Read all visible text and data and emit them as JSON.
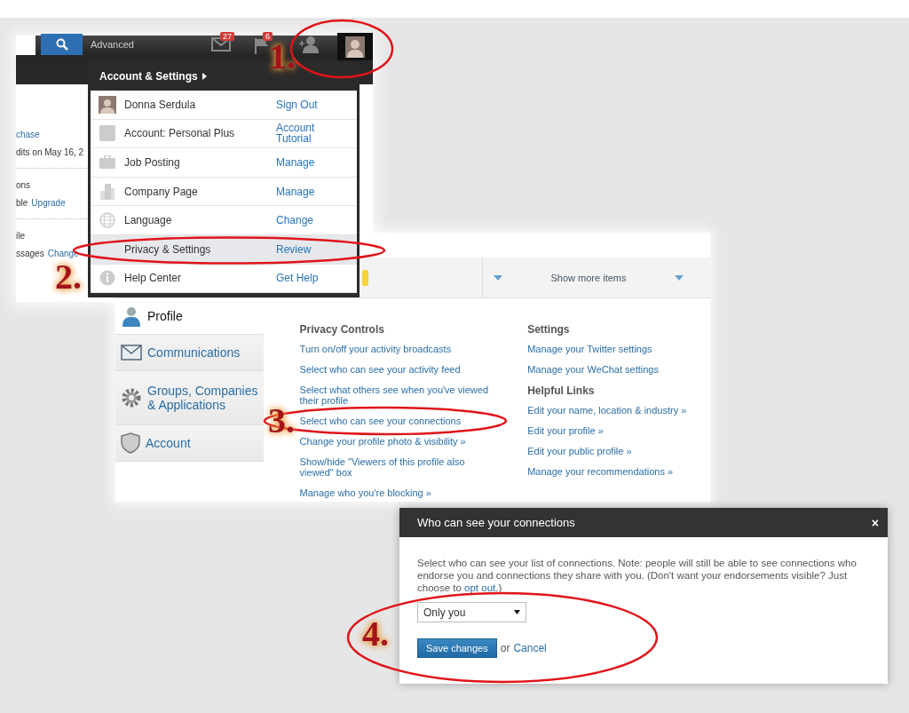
{
  "navbar": {
    "advanced": "Advanced",
    "notifications": [
      {
        "kind": "mail",
        "count": "27"
      },
      {
        "kind": "flag",
        "count": "6"
      }
    ]
  },
  "background_page": {
    "lines": [
      {
        "parts": [
          {
            "text": "chase",
            "kind": "link"
          }
        ]
      },
      {
        "parts": [
          {
            "text": "dits on May 16, 2",
            "kind": "text"
          }
        ]
      },
      {
        "parts": [
          {
            "text": "ons",
            "kind": "text"
          }
        ]
      },
      {
        "parts": [
          {
            "text": "ble",
            "kind": "text"
          },
          {
            "text": "Upgrade",
            "kind": "link"
          }
        ]
      },
      {
        "parts": [
          {
            "text": "ile",
            "kind": "text"
          }
        ]
      },
      {
        "parts": [
          {
            "text": "ssages",
            "kind": "text"
          },
          {
            "text": "Change",
            "kind": "link"
          }
        ]
      }
    ]
  },
  "menu": {
    "title": "Account & Settings",
    "rows": [
      {
        "kind": "avatar",
        "label": "Donna Serdula",
        "action": "Sign Out",
        "selected": false
      },
      {
        "kind": "logo",
        "label": "Account: Personal Plus",
        "action": "Account Tutorial",
        "selected": false
      },
      {
        "kind": "briefcase",
        "label": "Job Posting",
        "action": "Manage",
        "selected": false
      },
      {
        "kind": "building",
        "label": "Company Page",
        "action": "Manage",
        "selected": false
      },
      {
        "kind": "globe",
        "label": "Language",
        "action": "Change",
        "selected": false
      },
      {
        "kind": "plain",
        "label": "Privacy & Settings",
        "action": "Review",
        "selected": true
      },
      {
        "kind": "info",
        "label": "Help Center",
        "action": "Get Help",
        "selected": false
      }
    ]
  },
  "settings": {
    "show_more": "Show more items",
    "nav": [
      {
        "kind": "person",
        "label": "Profile",
        "selected": true
      },
      {
        "kind": "envelope",
        "label": "Communications",
        "selected": false
      },
      {
        "kind": "gear",
        "label": "Groups, Companies & Applications",
        "selected": false
      },
      {
        "kind": "shield",
        "label": "Account",
        "selected": false
      }
    ],
    "privacy_controls": {
      "heading": "Privacy Controls",
      "links": [
        "Turn on/off your activity broadcasts",
        "Select who can see your activity feed",
        "Select what others see when you've viewed their profile",
        "Select who can see your connections",
        "Change your profile photo & visibility »",
        "Show/hide \"Viewers of this profile also viewed\" box",
        "Manage who you're blocking »"
      ]
    },
    "settings_links": {
      "heading": "Settings",
      "links": [
        "Manage your Twitter settings",
        "Manage your WeChat settings"
      ]
    },
    "helpful_links": {
      "heading": "Helpful Links",
      "links": [
        "Edit your name, location & industry »",
        "Edit your profile »",
        "Edit your public profile »",
        "Manage your recommendations »"
      ]
    }
  },
  "dialog": {
    "title": "Who can see your connections",
    "close": "×",
    "text_before": "Select who can see your list of connections. Note: people will still be able to see connections who endorse you and connections they share with you. (Don't want your endorsements visible? Just choose to ",
    "link": "opt out",
    "text_after": ".)",
    "select_value": "Only you",
    "save": "Save changes",
    "or": "or",
    "cancel": "Cancel"
  },
  "annotations": [
    {
      "number": "1."
    },
    {
      "number": "2."
    },
    {
      "number": "3."
    },
    {
      "number": "4."
    }
  ]
}
